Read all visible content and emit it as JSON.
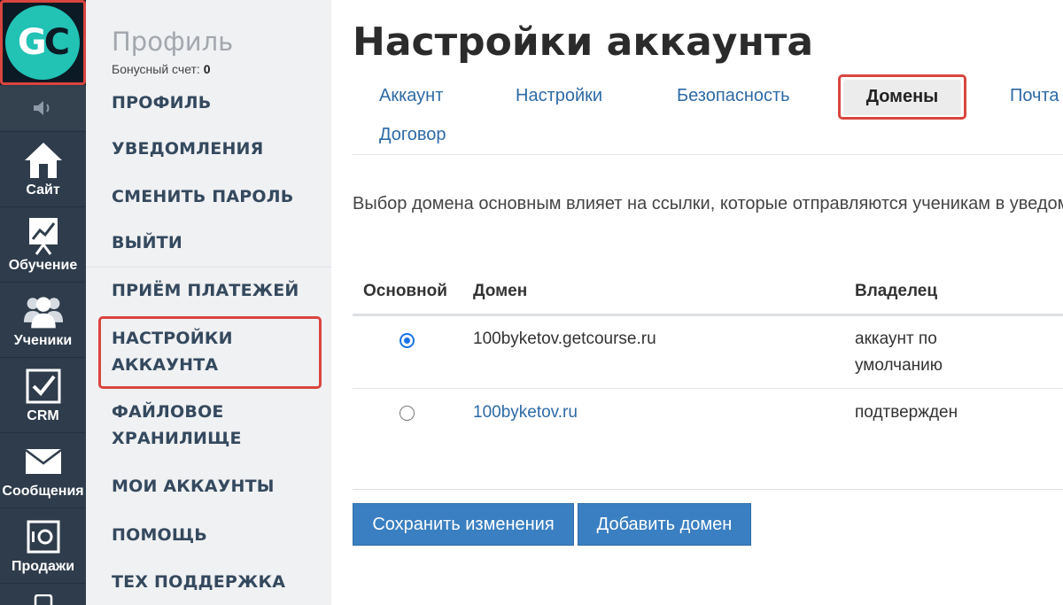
{
  "brand": {
    "logo_letters": [
      "G",
      "C"
    ],
    "colors": {
      "accent": "#22c2b5",
      "rail": "#2e3c4b",
      "highlight": "#d9453f",
      "link": "#2d6aa6",
      "button": "#3a7fc1"
    }
  },
  "rail": {
    "sound_icon": "speaker-icon",
    "items": [
      {
        "label": "Сайт",
        "icon": "home-icon"
      },
      {
        "label": "Обучение",
        "icon": "chart-board-icon"
      },
      {
        "label": "Ученики",
        "icon": "users-icon"
      },
      {
        "label": "CRM",
        "icon": "checkbox-icon"
      },
      {
        "label": "Сообщения",
        "icon": "envelope-icon"
      },
      {
        "label": "Продажи",
        "icon": "safe-icon"
      }
    ]
  },
  "menu": {
    "title": "Профиль",
    "bonus_label": "Бонусный счет:",
    "bonus_value": "0",
    "items": [
      "ПРОФИЛЬ",
      "УВЕДОМЛЕНИЯ",
      "СМЕНИТЬ ПАРОЛЬ",
      "ВЫЙТИ",
      "ПРИЁМ ПЛАТЕЖЕЙ",
      "НАСТРОЙКИ",
      "АККАУНТА",
      "ФАЙЛОВОЕ",
      "ХРАНИЛИЩЕ",
      "МОИ АККАУНТЫ",
      "ПОМОЩЬ",
      "ТЕХ ПОДДЕРЖКА"
    ]
  },
  "main": {
    "title": "Настройки аккаунта",
    "tabs": [
      "Аккаунт",
      "Настройки",
      "Безопасность",
      "Домены",
      "Почта",
      "Договор"
    ],
    "active_tab": "Домены",
    "description": "Выбор домена основным влияет на ссылки, которые отправляются ученикам в уведомлениях",
    "table": {
      "headers": [
        "Основной",
        "Домен",
        "Владелец"
      ],
      "rows": [
        {
          "primary": true,
          "domain": "100byketov.getcourse.ru",
          "owner_line1": "аккаунт по",
          "owner_line2": "умолчанию"
        },
        {
          "primary": false,
          "domain": "100byketov.ru",
          "owner_line1": "подтвержден",
          "owner_line2": ""
        }
      ]
    },
    "buttons": {
      "save": "Сохранить изменения",
      "add": "Добавить домен"
    }
  }
}
